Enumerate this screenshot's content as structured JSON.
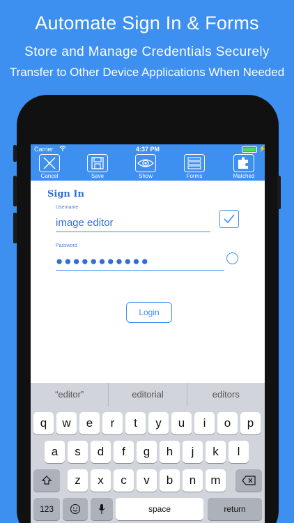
{
  "promo": {
    "line1": "Automate Sign In & Forms",
    "line2": "Store and Manage Credentials Securely",
    "line3": "Transfer to Other Device Applications When Needed"
  },
  "status_bar": {
    "carrier": "Carrier",
    "time": "4:37 PM"
  },
  "toolbar": {
    "cancel_label": "Cancel",
    "save_label": "Save",
    "show_label": "Show",
    "forms_label": "Forms",
    "matched_label": "Matched"
  },
  "form": {
    "title": "Sign In",
    "username_label": "Username",
    "username_value": "image editor",
    "password_label": "Password",
    "password_value": "●●●●●●●●●●●",
    "login_label": "Login"
  },
  "keyboard": {
    "suggestions": [
      "“editor”",
      "editorial",
      "editors"
    ],
    "row1": [
      "q",
      "w",
      "e",
      "r",
      "t",
      "y",
      "u",
      "i",
      "o",
      "p"
    ],
    "row2": [
      "a",
      "s",
      "d",
      "f",
      "g",
      "h",
      "j",
      "k",
      "l"
    ],
    "row3": [
      "z",
      "x",
      "c",
      "v",
      "b",
      "n",
      "m"
    ],
    "numbers_label": "123",
    "space_label": "space",
    "return_label": "return"
  },
  "colors": {
    "background": "#3d8ff0",
    "accent": "#3d8ff0",
    "text_blue": "#2f6fd8"
  }
}
